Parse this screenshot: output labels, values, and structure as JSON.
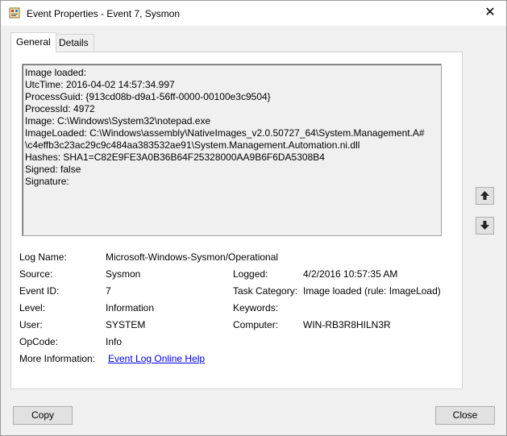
{
  "window": {
    "title": "Event Properties - Event 7, Sysmon",
    "icon": "event-viewer-icon",
    "close_glyph": "✕"
  },
  "tabs": [
    {
      "label": "General",
      "active": true
    },
    {
      "label": "Details",
      "active": false
    }
  ],
  "message": {
    "lines": [
      "Image loaded:",
      "UtcTime: 2016-04-02 14:57:34.997",
      "ProcessGuid: {913cd08b-d9a1-56ff-0000-00100e3c9504}",
      "ProcessId: 4972",
      "Image: C:\\Windows\\System32\\notepad.exe",
      "ImageLoaded: C:\\Windows\\assembly\\NativeImages_v2.0.50727_64\\System.Management.A#",
      "\\c4effb3c23ac29c9c484aa383532ae91\\System.Management.Automation.ni.dll",
      "Hashes: SHA1=C82E9FE3A0B36B64F25328000AA9B6F6DA5308B4",
      "Signed: false",
      "Signature:"
    ]
  },
  "nav": {
    "up_glyph": "🡅",
    "down_glyph": "🡇"
  },
  "fields": {
    "log_name_label": "Log Name:",
    "log_name_value": "Microsoft-Windows-Sysmon/Operational",
    "source_label": "Source:",
    "source_value": "Sysmon",
    "logged_label": "Logged:",
    "logged_value": "4/2/2016 10:57:35 AM",
    "event_id_label": "Event ID:",
    "event_id_value": "7",
    "task_category_label": "Task Category:",
    "task_category_value": "Image loaded (rule: ImageLoad)",
    "level_label": "Level:",
    "level_value": "Information",
    "keywords_label": "Keywords:",
    "keywords_value": "",
    "user_label": "User:",
    "user_value": "SYSTEM",
    "computer_label": "Computer:",
    "computer_value": "WIN-RB3R8HILN3R",
    "opcode_label": "OpCode:",
    "opcode_value": "Info",
    "more_info_label": "More Information:",
    "more_info_link": "Event Log Online Help"
  },
  "buttons": {
    "copy": "Copy",
    "close": "Close"
  }
}
